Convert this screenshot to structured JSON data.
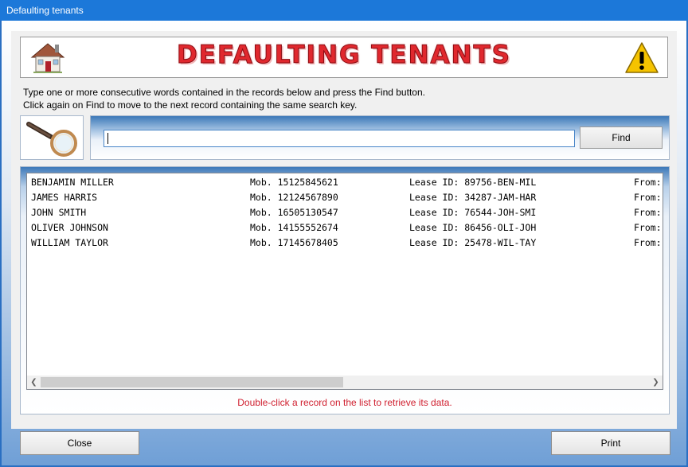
{
  "window": {
    "title": "Defaulting tenants"
  },
  "banner": {
    "title": "DEFAULTING TENANTS",
    "left_icon": "house-icon",
    "right_icon": "warning-icon"
  },
  "instructions": {
    "line1": "Type one or more consecutive words contained in the records below and press the Find button.",
    "line2": "Click again on Find to move to the next record containing the same search key."
  },
  "search": {
    "value": "",
    "find_label": "Find",
    "icon": "magnifier-icon"
  },
  "records": [
    {
      "name": "BENJAMIN MILLER",
      "mobile": "Mob. 15125845621",
      "lease": "Lease ID: 89756-BEN-MIL",
      "from": "From:"
    },
    {
      "name": "JAMES HARRIS",
      "mobile": "Mob. 12124567890",
      "lease": "Lease ID: 34287-JAM-HAR",
      "from": "From:"
    },
    {
      "name": "JOHN SMITH",
      "mobile": "Mob. 16505130547",
      "lease": "Lease ID: 76544-JOH-SMI",
      "from": "From:"
    },
    {
      "name": "OLIVER JOHNSON",
      "mobile": "Mob. 14155552674",
      "lease": "Lease ID: 86456-OLI-JOH",
      "from": "From:"
    },
    {
      "name": "WILLIAM TAYLOR",
      "mobile": "Mob. 17145678405",
      "lease": "Lease ID: 25478-WIL-TAY",
      "from": "From:"
    }
  ],
  "hint": "Double-click a record on the list to retrieve its data.",
  "buttons": {
    "close": "Close",
    "print": "Print"
  },
  "colors": {
    "titlebar": "#1c78d9",
    "banner_text": "#e0282e",
    "hint_text": "#d02030"
  }
}
